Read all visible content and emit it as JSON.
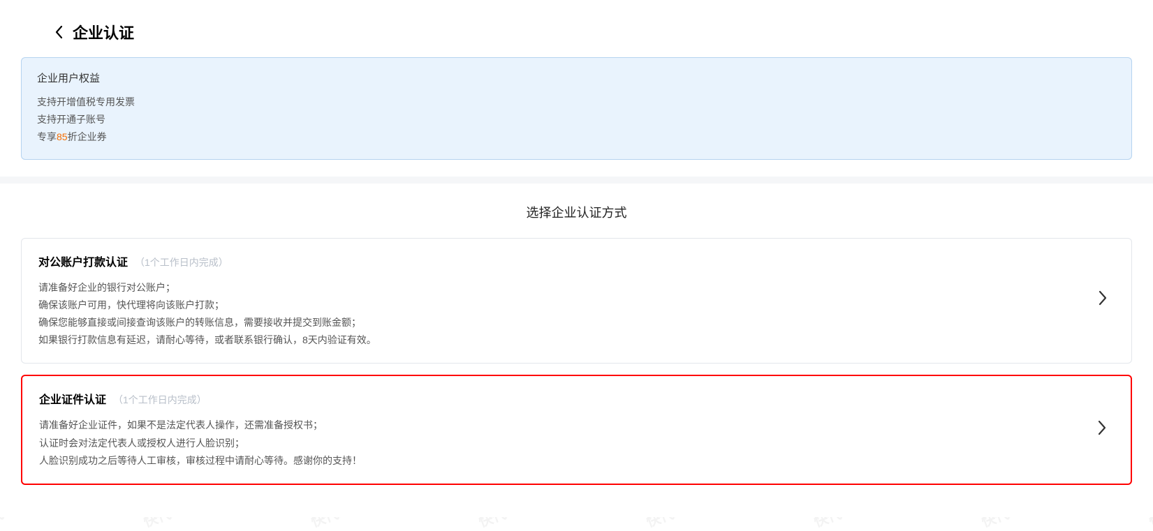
{
  "watermark": "快代理 kuaidaili.com",
  "header": {
    "title": "企业认证"
  },
  "benefits": {
    "title": "企业用户权益",
    "line1": "支持开增值税专用发票",
    "line2": "支持开通子账号",
    "line3_prefix": "专享",
    "line3_discount": "85",
    "line3_suffix": "折企业券"
  },
  "section_title": "选择企业认证方式",
  "methods": [
    {
      "title": "对公账户打款认证",
      "note": "（1个工作日内完成）",
      "desc1": "请准备好企业的银行对公账户；",
      "desc2": "确保该账户可用，快代理将向该账户打款；",
      "desc3": "确保您能够直接或间接查询该账户的转账信息，需要接收并提交到账金额；",
      "desc4": "如果银行打款信息有延迟，请耐心等待，或者联系银行确认，8天内验证有效。"
    },
    {
      "title": "企业证件认证",
      "note": "（1个工作日内完成）",
      "desc1": "请准备好企业证件，如果不是法定代表人操作，还需准备授权书；",
      "desc2": "认证时会对法定代表人或授权人进行人脸识别；",
      "desc3": "人脸识别成功之后等待人工审核，审核过程中请耐心等待。感谢你的支持！"
    }
  ]
}
